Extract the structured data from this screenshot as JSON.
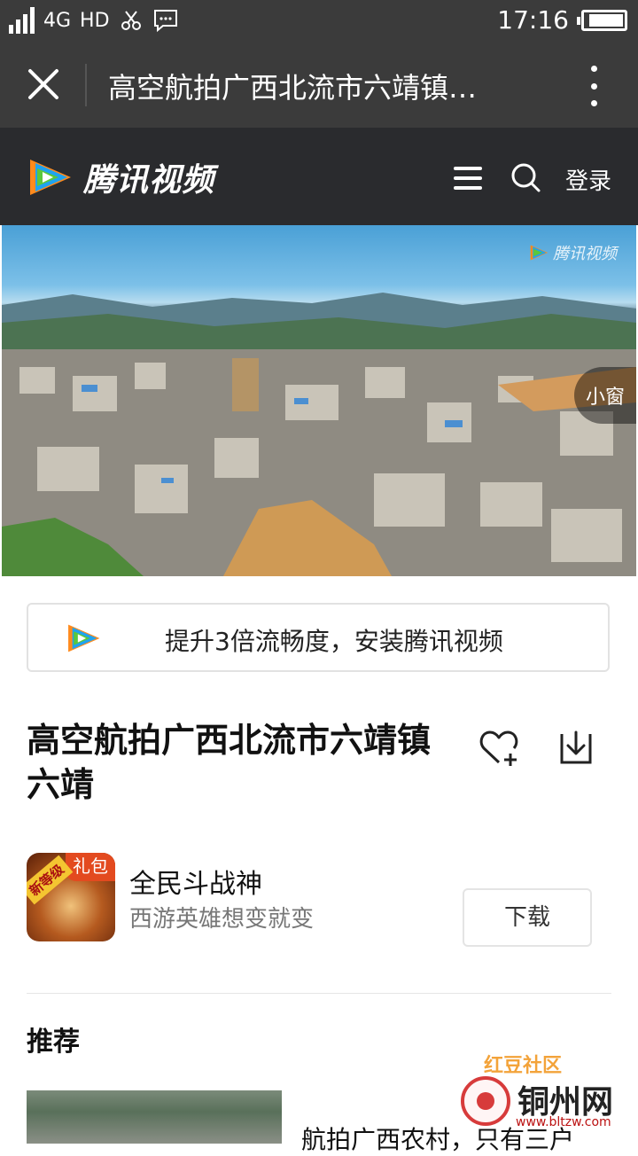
{
  "status_bar": {
    "network": "4G",
    "hd": "HD",
    "time": "17:16",
    "battery_level": 0.95
  },
  "browser": {
    "title": "高空航拍广西北流市六靖镇…"
  },
  "site_header": {
    "logo_text": "腾讯视频",
    "login_label": "登录"
  },
  "video": {
    "watermark": "腾讯视频",
    "mini_window_label": "小窗"
  },
  "install_banner": {
    "text": "提升3倍流畅度，安装腾讯视频"
  },
  "video_info": {
    "title": "高空航拍广西北流市六靖镇六靖"
  },
  "ad": {
    "icon_tag": "礼包",
    "icon_badge": "新等级",
    "name": "全民斗战神",
    "description": "西游英雄想变就变",
    "download_label": "下载"
  },
  "recommend": {
    "section_title": "推荐",
    "items": [
      {
        "title": "航拍广西农村，只有三户"
      }
    ]
  },
  "site_watermark": {
    "community": "红豆社区",
    "name": "铜州网",
    "url": "www.bltzw.com"
  },
  "colors": {
    "status_bg": "#3b3b3b",
    "header_bg": "#2a2b2e",
    "accent_orange": "#ff8a1c",
    "accent_blue": "#1fa3f0",
    "accent_green": "#5ac83c"
  }
}
